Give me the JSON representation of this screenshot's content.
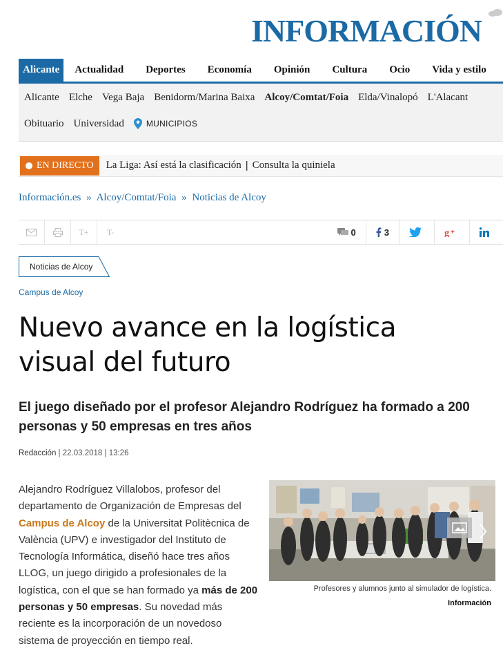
{
  "header": {
    "logo_text": "INFORMACIÓN",
    "brand_color": "#1b6aa5"
  },
  "main_nav": [
    "Alicante",
    "Actualidad",
    "Deportes",
    "Economía",
    "Opinión",
    "Cultura",
    "Ocio",
    "Vida y estilo"
  ],
  "sub_nav": {
    "row1": [
      "Alicante",
      "Elche",
      "Vega Baja",
      "Benidorm/Marina Baixa",
      "Alcoy/Comtat/Foia",
      "Elda/Vinalopó",
      "L'Alacant"
    ],
    "row2": [
      "Obituario",
      "Universidad"
    ],
    "municipios": "MUNICIPIOS"
  },
  "live": {
    "badge": "EN DIRECTO",
    "link1": "La Liga: Así está la clasificación",
    "link2": "Consulta la quiniela",
    "accent": "#e2711d"
  },
  "breadcrumb": [
    "Información.es",
    "Alcoy/Comtat/Foia",
    "Noticias de Alcoy"
  ],
  "tools": {
    "font_up": "T+",
    "font_down": "T-",
    "comments_count": "0",
    "facebook_count": "3"
  },
  "article": {
    "section_tag": "Noticias de Alcoy",
    "kicker": "Campus de Alcoy",
    "headline": "Nuevo avance en la logística visual del futuro",
    "subtitle": "El juego diseñado por el profesor Alejandro Rodríguez ha formado a 200 personas y 50 empresas en tres años",
    "author": "Redacción",
    "date": "22.03.2018",
    "time": "13:26",
    "body": {
      "p1_a": "Alejandro Rodríguez Villalobos, profesor del departamento de Organización de Empresas del ",
      "p1_link": "Campus de Alcoy",
      "p1_b": " de la Universitat Politècnica de València (UPV) e investigador del Instituto de Tecnología Informática, diseñó hace tres años LLOG, un juego dirigido a profesionales de la logística, con el que se han formado ya ",
      "p1_bold": "más de 200 personas y 50 empresas",
      "p1_c": ". Su novedad más reciente es la incorporación de un novedoso sistema de proyección en tiempo real."
    },
    "photo": {
      "caption": "Profesores y alumnos junto al simulador de logística.",
      "credit": "Información"
    }
  }
}
